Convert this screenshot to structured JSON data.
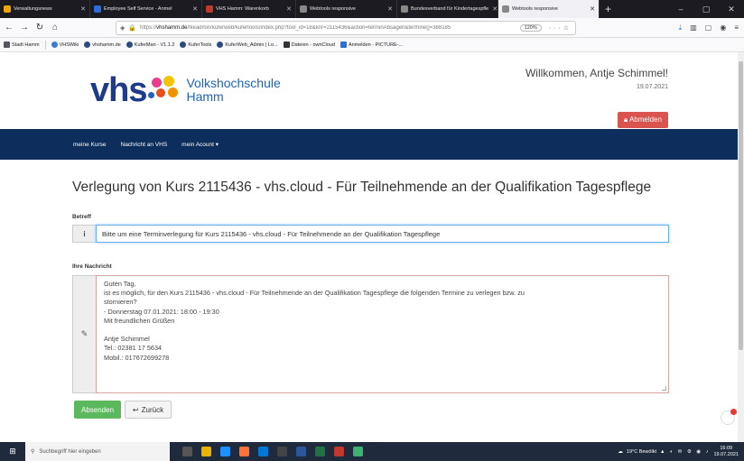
{
  "browser": {
    "tabs": [
      {
        "label": "Verwaltungsnews",
        "color": "#f0a500"
      },
      {
        "label": "Employee Self Service - Anmel",
        "color": "#2a6fdb"
      },
      {
        "label": "VHS Hamm: Warenkorb",
        "color": "#c0392b"
      },
      {
        "label": "Webtools responsive",
        "color": "#888888"
      },
      {
        "label": "Bundesverband für Kindertagespfle",
        "color": "#888888"
      },
      {
        "label": "Webtools responsive",
        "color": "#888888"
      }
    ],
    "new_tab": "+",
    "window_controls": [
      "–",
      "▢",
      "✕"
    ],
    "url_prefix": "https://",
    "url_domain": "vhshamm.de",
    "url_path": "/fileadmin/kuferweb/kufertools/index.php?tool_id=18&knr=2115436&action=terminAbsagen&termine[]=388185",
    "zoom": "120%",
    "bookmarks": [
      "Stadt Hamm",
      "VHSWiki",
      "vhshamm.de",
      "KuferMan - V1.1.2",
      "KuferTools",
      "KuferWeb_Admin | Lo...",
      "Dateien - ownCloud",
      "Anmelden - PICTURE-..."
    ]
  },
  "site": {
    "logo_text": "vhs",
    "logo_name_line1": "Volkshochschule",
    "logo_name_line2": "Hamm",
    "welcome": "Willkommen, Antje Schimmel!",
    "date": "19.07.2021",
    "logout_label": "Abmelden",
    "nav": [
      "meine Kurse",
      "Nachricht an VHS",
      "mein Acount ▾"
    ]
  },
  "form": {
    "title": "Verlegung von Kurs 2115436 - vhs.cloud - Für Teilnehmende an der Qualifikation Tagespflege",
    "betreff_label": "Betreff",
    "betreff_value": "Bitte um eine Terminverlegung für Kurs 2115436 - vhs.cloud - Für Teilnehmende an der Qualifikation Tagespflege",
    "message_label": "Ihre Nachricht",
    "message_value": "Guten Tag,\nist es möglich, für den Kurs 2115436 - vhs.cloud - Für Teilnehmende an der Qualifikation Tagespflege die folgenden Termine zu verlegen bzw. zu\nstornieren?\n- Donnerstag 07.01.2021: 18:00 - 19:30\nMit freundlichen Grüßen\n\nAntje Schimmel\nTel.: 02381 17 5634\nMobil.: 017672699278",
    "send_label": "Absenden",
    "back_label": "Zurück"
  },
  "taskbar": {
    "search_placeholder": "Suchbegriff hier eingeben",
    "weather": "19°C Bewölkt",
    "time": "16:09",
    "date": "19.07.2021"
  },
  "colors": {
    "nav_bg": "#0d2e5c",
    "logo_blue": "#1f3a8a",
    "logout_red": "#d9534f",
    "send_green": "#5cb85c"
  }
}
